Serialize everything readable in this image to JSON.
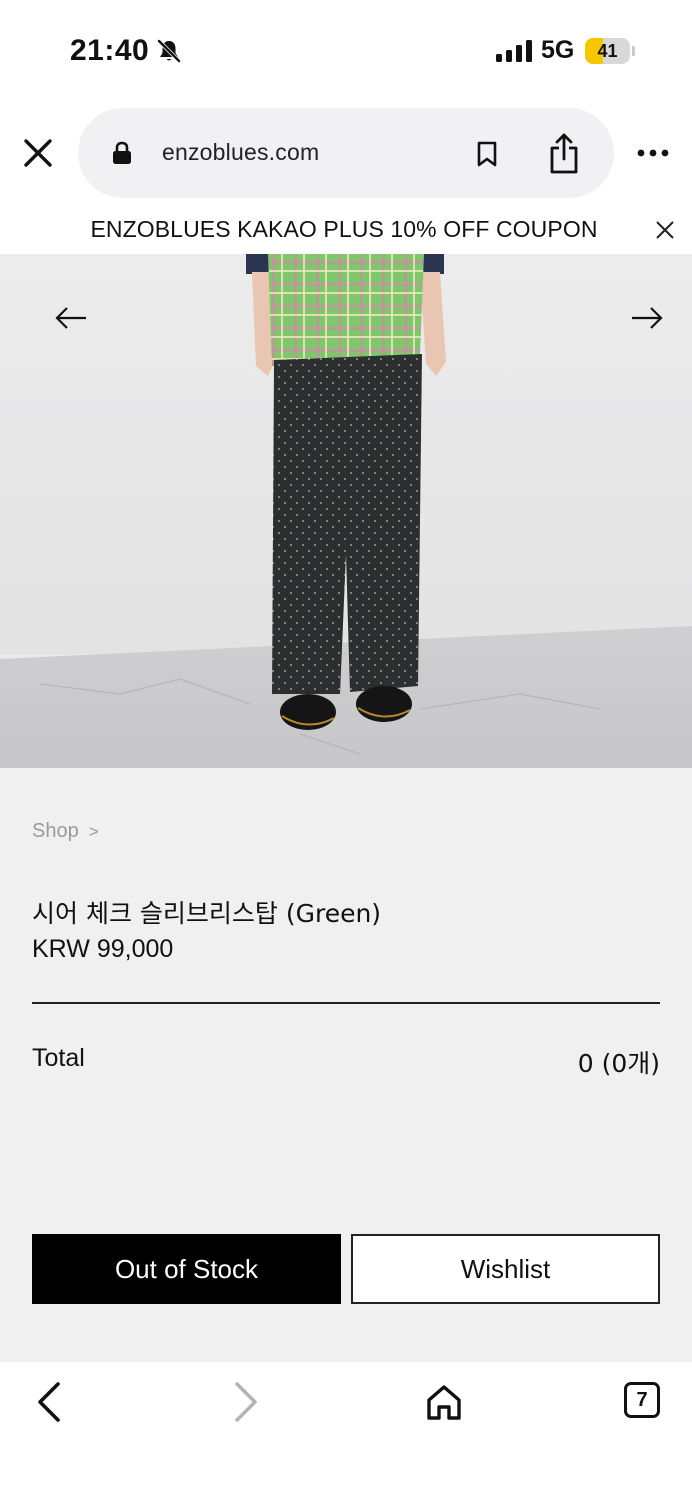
{
  "status_bar": {
    "time": "21:40",
    "network": "5G",
    "battery_percent": 41,
    "battery_label": "41"
  },
  "browser": {
    "url": "enzoblues.com",
    "tab_count": "7"
  },
  "banner": {
    "text": "ENZOBLUES KAKAO PLUS 10% OFF COUPON"
  },
  "product": {
    "breadcrumb": "Shop",
    "breadcrumb_separator": ">",
    "name": "시어 체크 슬리브리스탑 (Green)",
    "price": "KRW 99,000",
    "total_label": "Total",
    "total_value": "0 (0개)"
  },
  "actions": {
    "out_of_stock_label": "Out of Stock",
    "wishlist_label": "Wishlist"
  },
  "colors": {
    "page_background": "#f0f0f0",
    "primary_button": "#000000",
    "battery_fill": "#f6c600"
  }
}
